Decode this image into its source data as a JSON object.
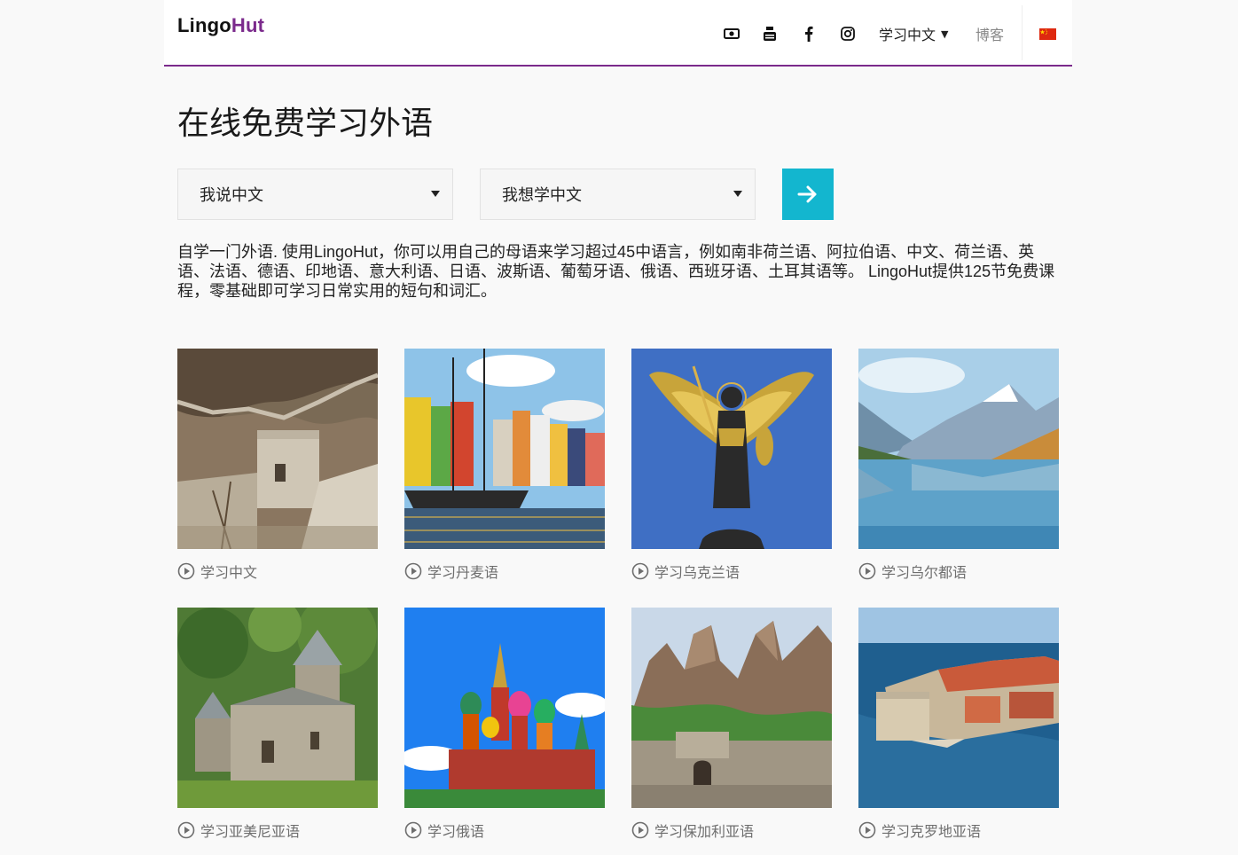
{
  "header": {
    "logo": {
      "part1": "Lingo",
      "part2": "Hut"
    },
    "nav": {
      "language_menu": "学习中文",
      "blog": "博客"
    },
    "icons": [
      "camera-icon",
      "youtube-icon",
      "facebook-icon",
      "instagram-icon",
      "china-flag-icon"
    ]
  },
  "hero": {
    "title": "在线免费学习外语",
    "speak_select": {
      "value": "我说中文"
    },
    "learn_select": {
      "value": "我想学中文"
    },
    "go_button_icon": "arrow-right-icon",
    "intro": "自学一门外语. 使用LingoHut，你可以用自己的母语来学习超过45中语言，例如南非荷兰语、阿拉伯语、中文、荷兰语、英语、法语、德语、印地语、意大利语、日语、波斯语、葡萄牙语、俄语、西班牙语、土耳其语等。 LingoHut提供125节免费课程，零基础即可学习日常实用的短句和词汇。"
  },
  "courses": [
    {
      "label": "学习中文"
    },
    {
      "label": "学习丹麦语"
    },
    {
      "label": "学习乌克兰语"
    },
    {
      "label": "学习乌尔都语"
    },
    {
      "label": "学习亚美尼亚语"
    },
    {
      "label": "学习俄语"
    },
    {
      "label": "学习保加利亚语"
    },
    {
      "label": "学习克罗地亚语"
    }
  ],
  "colors": {
    "brand_purple": "#7b2a8c",
    "go_button": "#13b6cf",
    "background": "#f9f9f9"
  }
}
